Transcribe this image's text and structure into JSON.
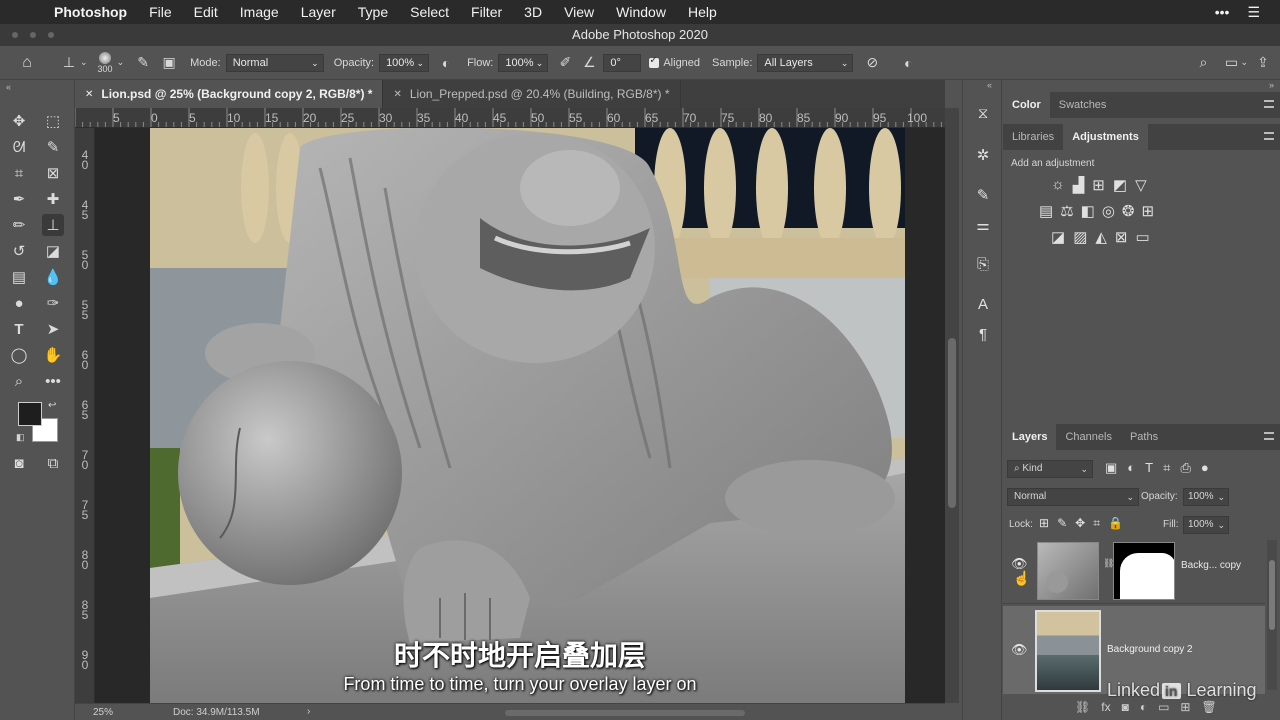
{
  "menubar": {
    "app_name": "Photoshop",
    "items": [
      "File",
      "Edit",
      "Image",
      "Layer",
      "Type",
      "Select",
      "Filter",
      "3D",
      "View",
      "Window",
      "Help"
    ]
  },
  "window": {
    "title": "Adobe Photoshop 2020"
  },
  "options": {
    "brush_size": "300",
    "mode_label": "Mode:",
    "mode_value": "Normal",
    "opacity_label": "Opacity:",
    "opacity_value": "100%",
    "flow_label": "Flow:",
    "flow_value": "100%",
    "angle_value": "0°",
    "aligned_label": "Aligned",
    "sample_label": "Sample:",
    "sample_value": "All Layers"
  },
  "tabs": [
    {
      "label": "Lion.psd @ 25% (Background copy 2, RGB/8*) *",
      "active": true
    },
    {
      "label": "Lion_Prepped.psd @ 20.4% (Building, RGB/8*) *",
      "active": false
    }
  ],
  "ruler": {
    "top": [
      "5",
      "0",
      "5",
      "10",
      "15",
      "20",
      "25",
      "30",
      "35",
      "40",
      "45",
      "50",
      "55",
      "60",
      "65",
      "70",
      "75",
      "80",
      "85",
      "90",
      "95",
      "100"
    ],
    "left": [
      [
        "4",
        "0"
      ],
      [
        "4",
        "5"
      ],
      [
        "5",
        "0"
      ],
      [
        "5",
        "5"
      ],
      [
        "6",
        "0"
      ],
      [
        "6",
        "5"
      ],
      [
        "7",
        "0"
      ],
      [
        "7",
        "5"
      ],
      [
        "8",
        "0"
      ],
      [
        "8",
        "5"
      ],
      [
        "9",
        "0"
      ]
    ]
  },
  "status": {
    "zoom": "25%",
    "doc": "Doc: 34.9M/113.5M"
  },
  "color_panel": {
    "tabs": [
      "Color",
      "Swatches"
    ]
  },
  "adjustments_panel": {
    "tabs": [
      "Libraries",
      "Adjustments"
    ],
    "hint": "Add an adjustment"
  },
  "layers_panel": {
    "tabs": [
      "Layers",
      "Channels",
      "Paths"
    ],
    "filter_kind": "Kind",
    "blend_mode": "Normal",
    "opacity_label": "Opacity:",
    "opacity_value": "100%",
    "lock_label": "Lock:",
    "fill_label": "Fill:",
    "fill_value": "100%",
    "layers": [
      {
        "name": "Backg... copy",
        "visible": true,
        "has_mask": true
      },
      {
        "name": "Background copy 2",
        "visible": true,
        "selected": true
      }
    ]
  },
  "subtitles": {
    "chinese": "时不时地开启叠加层",
    "english": "From time to time, turn your overlay layer on"
  },
  "watermark": {
    "brand": "Linked",
    "suffix": "Learning"
  }
}
